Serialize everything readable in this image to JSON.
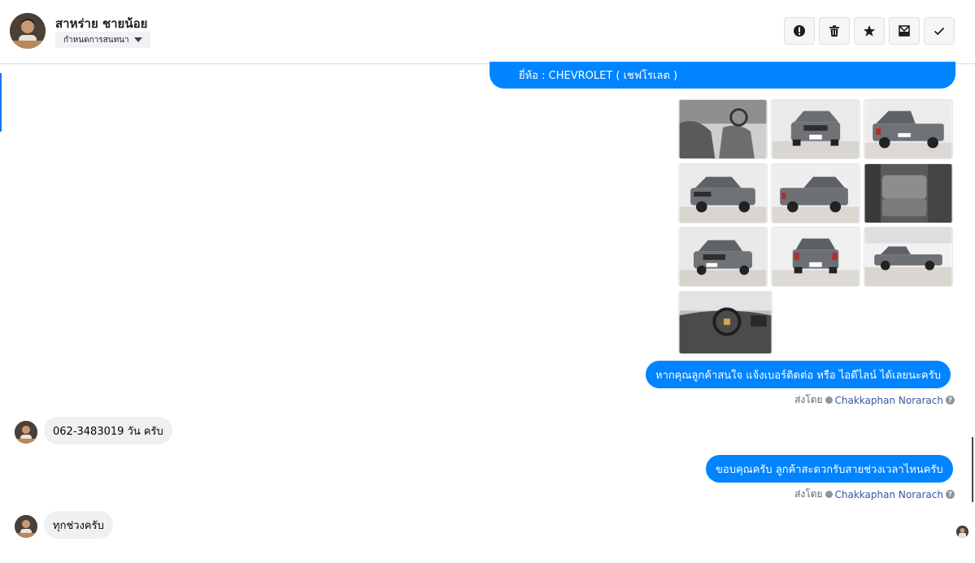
{
  "header": {
    "contact_name": "สาหร่าย ชายน้อย",
    "label_select": "กำหนดการสนทนา",
    "actions": [
      {
        "name": "report-button",
        "icon": "alert-circle-icon"
      },
      {
        "name": "delete-button",
        "icon": "trash-icon"
      },
      {
        "name": "star-button",
        "icon": "star-icon"
      },
      {
        "name": "mark-unread-button",
        "icon": "mail-icon"
      },
      {
        "name": "mark-done-button",
        "icon": "check-icon"
      }
    ]
  },
  "messages": {
    "brand_line": "ยี่ห้อ : CHEVROLET ( เชฟโรเลต )",
    "photo_count": 10,
    "msg_contact_request": "หากคุณลูกค้าสนใจ แจ้งเบอร์ติดต่อ หรือ ไอดีไลน์ ได้เลยนะครับ",
    "sent_by_prefix": "ส่งโดย",
    "sender_name": "Chakkaphan Norarach",
    "reply_phone": "062-3483019 วัน ครับ",
    "msg_time_question": "ขอบคุณครับ ลูกค้าสะดวกรับสายช่วงเวลาไหนครับ",
    "reply_anytime": "ทุกช่วงครับ",
    "help_glyph": "?"
  },
  "colors": {
    "outgoing_bubble": "#0084ff",
    "incoming_bubble": "#f0f0f0",
    "sender_link": "#385898"
  }
}
